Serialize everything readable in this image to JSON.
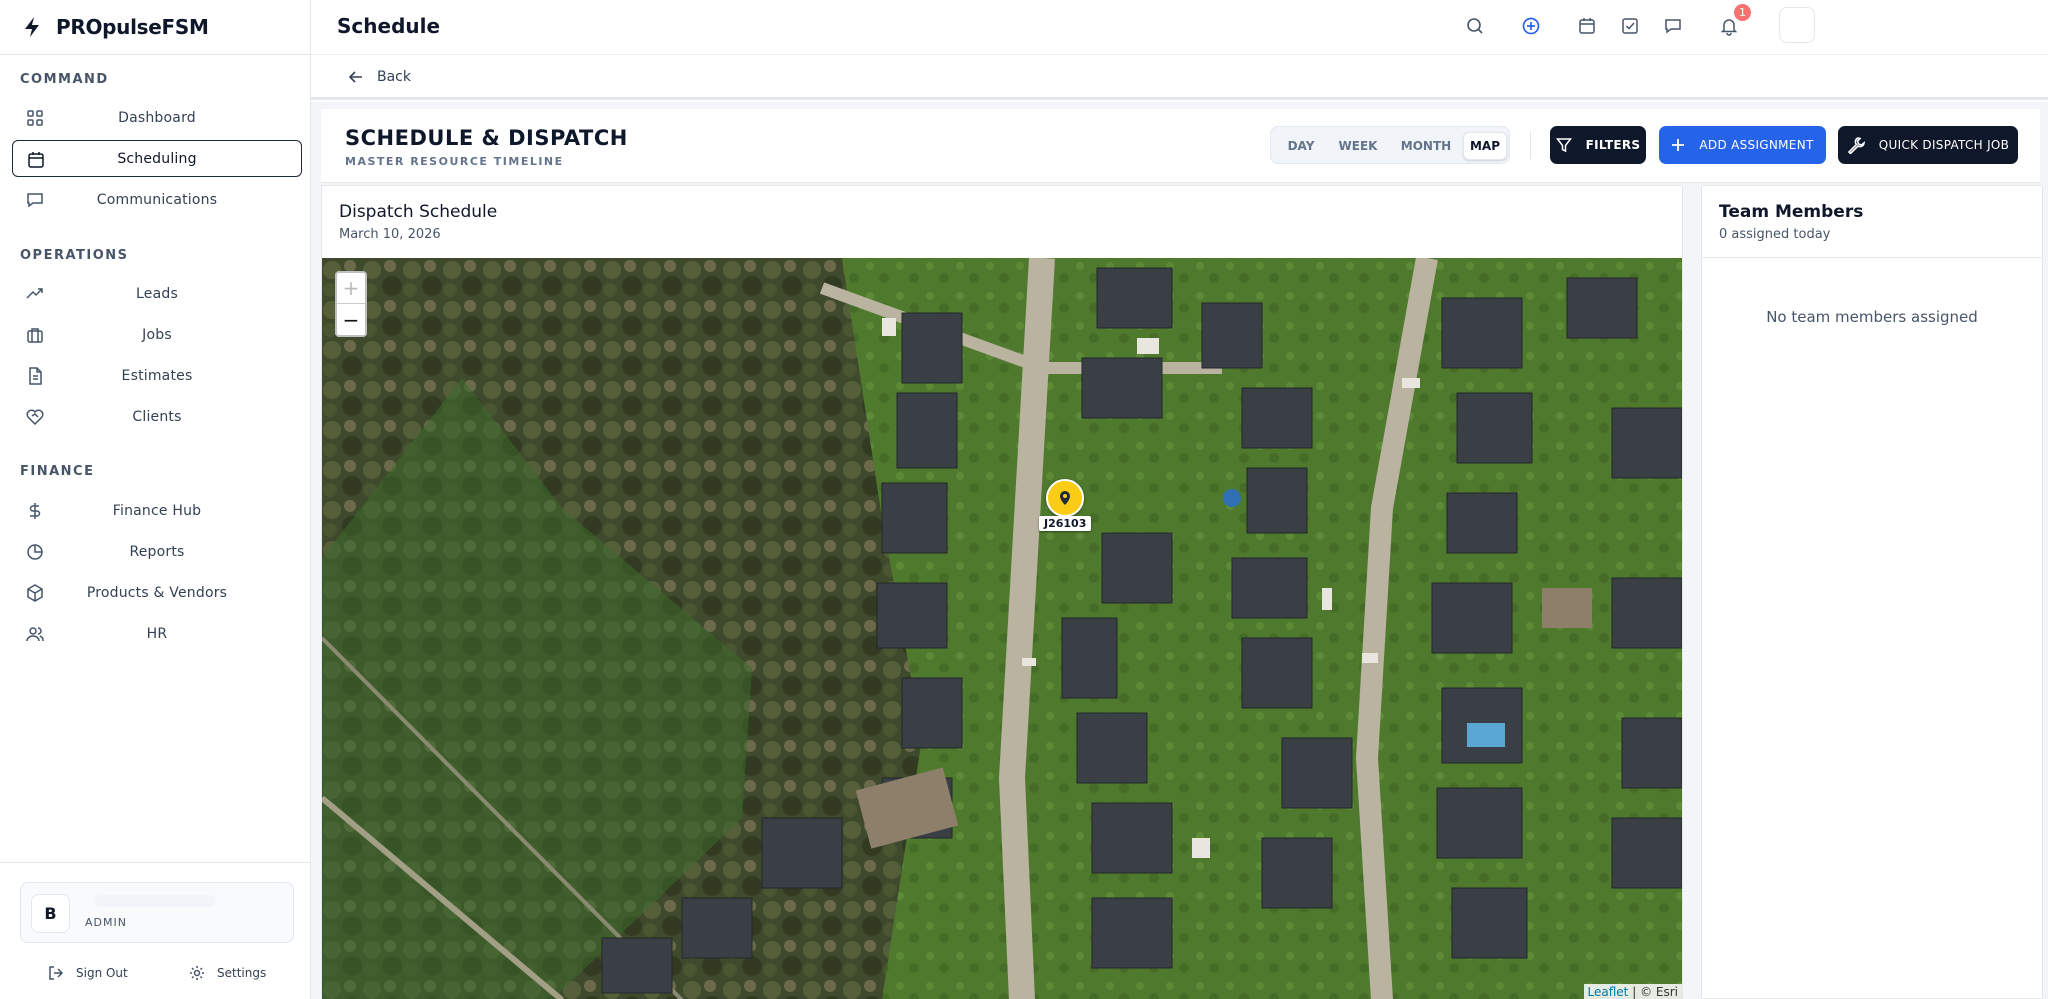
{
  "brand": {
    "name": "PROpulseFSM"
  },
  "sidebar": {
    "sections": [
      {
        "title": "COMMAND"
      },
      {
        "title": "OPERATIONS"
      },
      {
        "title": "FINANCE"
      }
    ],
    "items": [
      {
        "label": "Dashboard",
        "icon": "grid-icon"
      },
      {
        "label": "Scheduling",
        "icon": "calendar-icon",
        "active": true
      },
      {
        "label": "Communications",
        "icon": "message-icon"
      },
      {
        "label": "Leads",
        "icon": "trending-icon"
      },
      {
        "label": "Jobs",
        "icon": "briefcase-icon"
      },
      {
        "label": "Estimates",
        "icon": "document-icon"
      },
      {
        "label": "Clients",
        "icon": "handshake-icon"
      },
      {
        "label": "Finance Hub",
        "icon": "dollar-icon"
      },
      {
        "label": "Reports",
        "icon": "pie-chart-icon"
      },
      {
        "label": "Products & Vendors",
        "icon": "package-icon"
      },
      {
        "label": "HR",
        "icon": "users-icon"
      }
    ],
    "user": {
      "initial": "B",
      "role": "ADMIN"
    },
    "footer": {
      "sign_out": "Sign Out",
      "settings": "Settings"
    }
  },
  "topbar": {
    "title": "Schedule",
    "notification_count": "1",
    "icons": [
      "search-icon",
      "plus-circle-icon",
      "calendar-icon",
      "check-square-icon",
      "chat-icon",
      "bell-icon"
    ]
  },
  "back": {
    "label": "Back"
  },
  "header": {
    "title": "SCHEDULE & DISPATCH",
    "subtitle": "MASTER RESOURCE TIMELINE",
    "views": [
      "DAY",
      "WEEK",
      "MONTH",
      "MAP"
    ],
    "active_view": "MAP",
    "filters_label": "FILTERS",
    "add_label": "ADD ASSIGNMENT",
    "quick_label": "QUICK DISPATCH JOB"
  },
  "dispatch": {
    "title": "Dispatch Schedule",
    "date": "March 10, 2026",
    "zoom_in": "+",
    "zoom_out": "−",
    "marker_label": "J26103",
    "attribution_leaflet": "Leaflet",
    "attribution_rest": "| © Esri"
  },
  "team": {
    "title": "Team Members",
    "subtitle": "0 assigned today",
    "empty": "No team members assigned"
  },
  "colors": {
    "primary": "#2563eb",
    "dark": "#0f172a",
    "marker": "#facc15",
    "badge": "#f87171"
  }
}
